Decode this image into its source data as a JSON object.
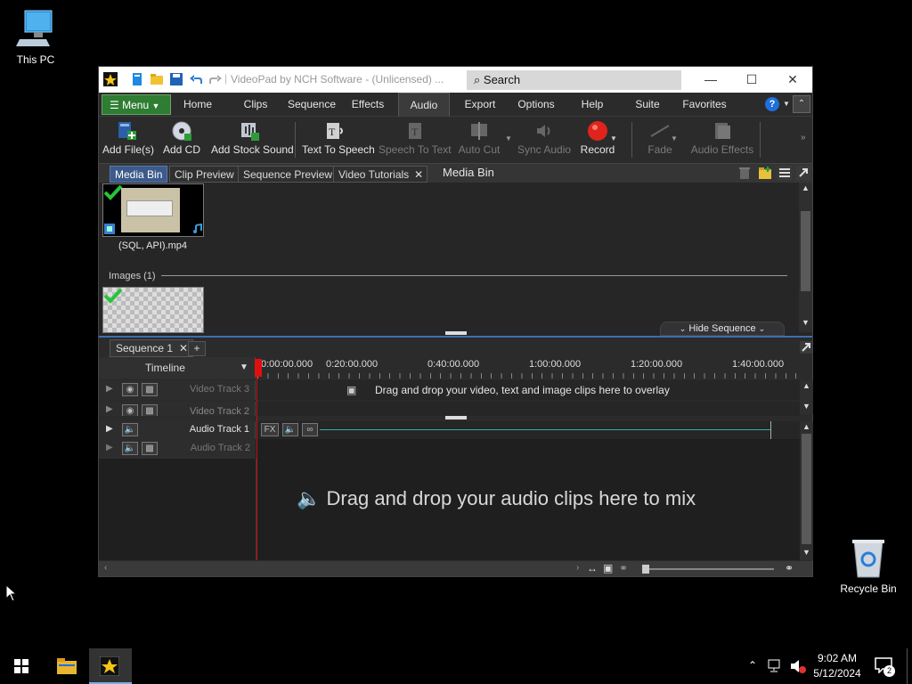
{
  "desktop": {
    "icons": [
      {
        "label": "This PC",
        "icon": "computer-icon"
      },
      {
        "label": "Recycle Bin",
        "icon": "recycle-bin-icon"
      }
    ]
  },
  "window": {
    "title": "VideoPad by NCH Software - (Unlicensed) ...",
    "search_placeholder": "Search",
    "controls": {
      "minimize": "—",
      "maximize": "☐",
      "close": "✕"
    }
  },
  "menu_tabs": {
    "menu_label": "Menu",
    "tabs": [
      "Home",
      "Clips",
      "Sequence",
      "Effects",
      "Audio",
      "Export",
      "Options",
      "Help",
      "Suite",
      "Favorites"
    ],
    "active": "Audio"
  },
  "toolbar": {
    "add_files": "Add File(s)",
    "add_cd": "Add CD",
    "add_stock_sound": "Add Stock Sound",
    "text_to_speech": "Text To Speech",
    "speech_to_text": "Speech To Text",
    "auto_cut": "Auto Cut",
    "sync_audio": "Sync Audio",
    "record": "Record",
    "fade": "Fade",
    "audio_effects": "Audio Effects"
  },
  "panel_tabs": {
    "tabs": [
      "Media Bin",
      "Clip Preview",
      "Sequence Preview",
      "Video Tutorials"
    ],
    "active": "Media Bin",
    "panel_title": "Media Bin"
  },
  "media_bin": {
    "video_clip_label": "(SQL, API).mp4",
    "images_header": "Images (1)",
    "hide_sequence": "Hide Sequence"
  },
  "sequence": {
    "tab_label": "Sequence 1",
    "add_tab": "+",
    "timeline_label": "Timeline",
    "ruler_ticks": [
      "0:00:00.000",
      "0:20:00.000",
      "0:40:00.000",
      "1:00:00.000",
      "1:20:00.000",
      "1:40:00.000"
    ],
    "video_tracks": [
      "Video Track 3",
      "Video Track 2"
    ],
    "video_drop_hint": "Drag and drop your video, text and image clips here to overlay",
    "audio_tracks": [
      "Audio Track 1",
      "Audio Track 2"
    ],
    "fx_label": "FX",
    "audio_drop_hint": "Drag and drop your audio clips here to mix"
  },
  "taskbar": {
    "time": "9:02 AM",
    "date": "5/12/2024",
    "notification_count": "2"
  },
  "colors": {
    "menu_green": "#2e7d32",
    "record_red": "#e0241c",
    "accent_blue": "#3c5a8a",
    "playhead": "#e01010"
  }
}
